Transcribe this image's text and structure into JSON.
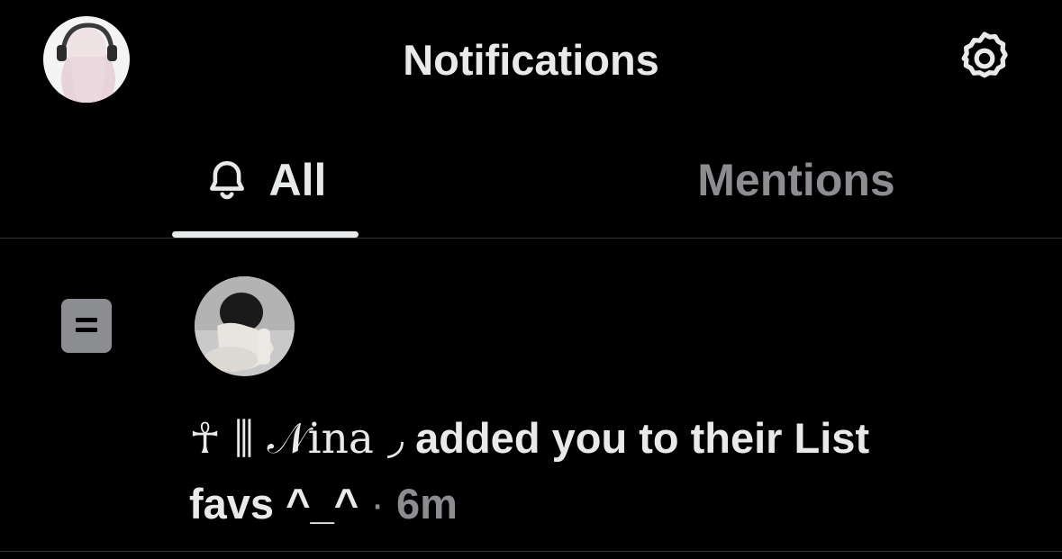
{
  "header": {
    "title": "Notifications",
    "avatar_icon": "user-avatar",
    "settings_icon": "gear-icon"
  },
  "tabs": [
    {
      "label": "All",
      "icon": "bell-icon",
      "active": true
    },
    {
      "label": "Mentions",
      "active": false
    }
  ],
  "notification": {
    "type_icon": "list-icon",
    "actor_name": "☥ ⫼ 𝒩ina ◞",
    "action_text": "added you to their List",
    "list_name": "favs ^_^",
    "separator": "·",
    "time": "6m"
  },
  "colors": {
    "background": "#000000",
    "primary_text": "#e7e9ea",
    "secondary_text": "#8b8d90",
    "divider": "#2f3336",
    "list_icon_bg": "#8b8d90"
  }
}
